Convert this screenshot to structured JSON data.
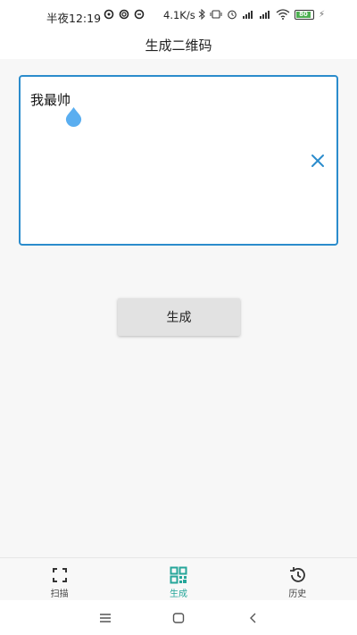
{
  "status_bar": {
    "time": "半夜12:19",
    "notif_icons": [
      "notif-app-icon-1",
      "notif-app-icon-2",
      "notif-app-icon-3"
    ],
    "net_speed": "4.1K/s",
    "system_icons": [
      "bluetooth-icon",
      "vibrate-icon",
      "alarm-icon",
      "hd-signal-icon",
      "signal-icon",
      "wifi-icon"
    ],
    "battery_level": "80"
  },
  "title": "生成二维码",
  "input": {
    "value": "我最帅",
    "border_color": "#2b8ccc"
  },
  "generate_button": "生成",
  "bottom_nav": {
    "items": [
      {
        "label": "扫描",
        "icon": "scan-icon",
        "active": false
      },
      {
        "label": "生成",
        "icon": "qr-code-icon",
        "active": true
      },
      {
        "label": "历史",
        "icon": "history-icon",
        "active": false
      }
    ],
    "active_color": "#26a69a"
  },
  "system_nav": [
    "menu-icon",
    "home-icon",
    "back-icon"
  ]
}
